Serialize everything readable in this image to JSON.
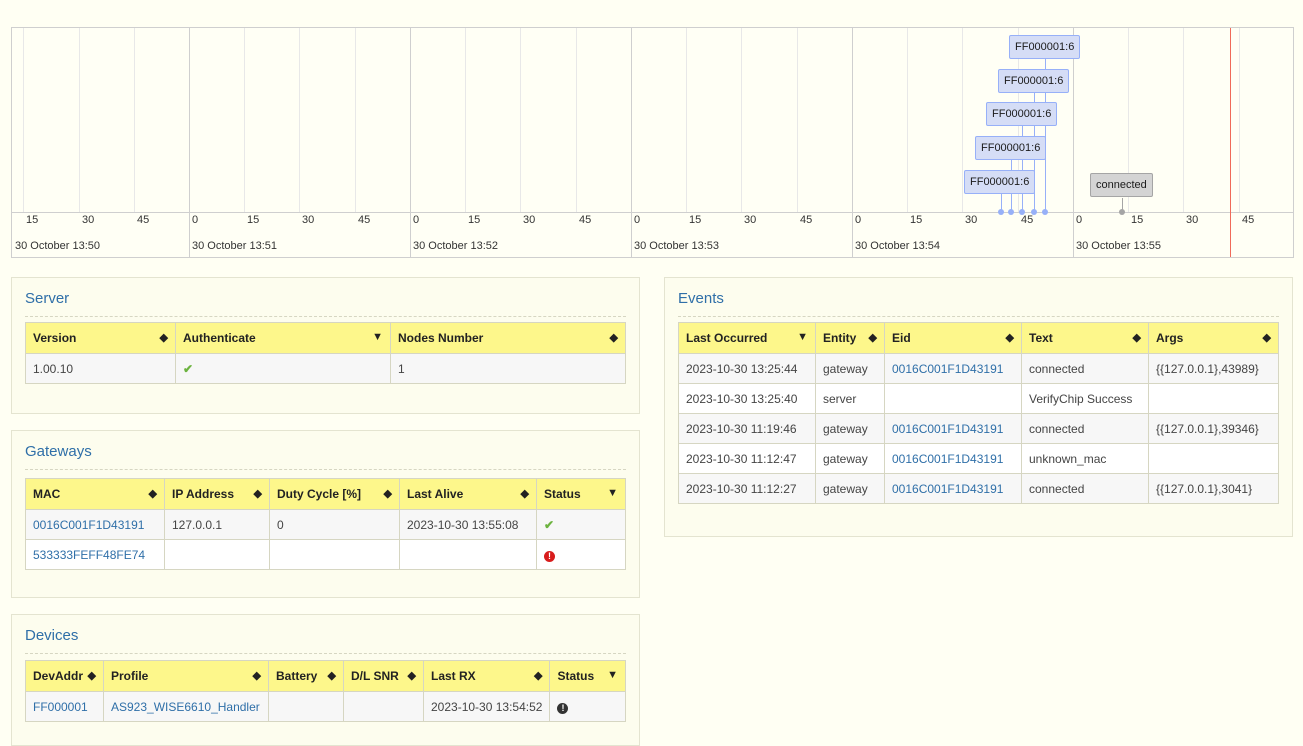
{
  "timeline": {
    "minutes": [
      {
        "label": "30 October 13:50",
        "ticks": [
          "15",
          "30",
          "45"
        ]
      },
      {
        "label": "30 October 13:51",
        "ticks": [
          "0",
          "15",
          "30",
          "45"
        ]
      },
      {
        "label": "30 October 13:52",
        "ticks": [
          "0",
          "15",
          "30",
          "45"
        ]
      },
      {
        "label": "30 October 13:53",
        "ticks": [
          "0",
          "15",
          "30",
          "45"
        ]
      },
      {
        "label": "30 October 13:54",
        "ticks": [
          "0",
          "15",
          "30",
          "45"
        ]
      },
      {
        "label": "30 October 13:55",
        "ticks": [
          "0",
          "15",
          "30",
          "45"
        ]
      }
    ],
    "items": [
      {
        "text": "FF000001:6",
        "kind": "frame"
      },
      {
        "text": "FF000001:6",
        "kind": "frame"
      },
      {
        "text": "FF000001:6",
        "kind": "frame"
      },
      {
        "text": "FF000001:6",
        "kind": "frame"
      },
      {
        "text": "FF000001:6",
        "kind": "frame"
      },
      {
        "text": "connected",
        "kind": "event"
      }
    ]
  },
  "server": {
    "title": "Server",
    "columns": [
      "Version",
      "Authenticate",
      "Nodes Number"
    ],
    "rows": [
      {
        "version": "1.00.10",
        "authenticate": "✔",
        "nodes": "1"
      }
    ]
  },
  "gateways": {
    "title": "Gateways",
    "columns": [
      "MAC",
      "IP Address",
      "Duty Cycle [%]",
      "Last Alive",
      "Status"
    ],
    "rows": [
      {
        "mac": "0016C001F1D43191",
        "ip": "127.0.0.1",
        "duty": "0",
        "alive": "2023-10-30 13:55:08",
        "status": "✔"
      },
      {
        "mac": "533333FEFF48FE74",
        "ip": "",
        "duty": "",
        "alive": "",
        "status": "!"
      }
    ]
  },
  "devices": {
    "title": "Devices",
    "columns": [
      "DevAddr",
      "Profile",
      "Battery",
      "D/L SNR",
      "Last RX",
      "Status"
    ],
    "rows": [
      {
        "devaddr": "FF000001",
        "profile": "AS923_WISE6610_Handler",
        "battery": "",
        "snr": "",
        "lastrx": "2023-10-30 13:54:52",
        "status": "!"
      }
    ]
  },
  "events": {
    "title": "Events",
    "columns": [
      "Last Occurred",
      "Entity",
      "Eid",
      "Text",
      "Args"
    ],
    "rows": [
      {
        "time": "2023-10-30 13:25:44",
        "entity": "gateway",
        "eid": "0016C001F1D43191",
        "text": "connected",
        "args": "{{127.0.0.1},43989}"
      },
      {
        "time": "2023-10-30 13:25:40",
        "entity": "server",
        "eid": "",
        "text": "VerifyChip Success",
        "args": ""
      },
      {
        "time": "2023-10-30 11:19:46",
        "entity": "gateway",
        "eid": "0016C001F1D43191",
        "text": "connected",
        "args": "{{127.0.0.1},39346}"
      },
      {
        "time": "2023-10-30 11:12:47",
        "entity": "gateway",
        "eid": "0016C001F1D43191",
        "text": "unknown_mac",
        "args": ""
      },
      {
        "time": "2023-10-30 11:12:27",
        "entity": "gateway",
        "eid": "0016C001F1D43191",
        "text": "connected",
        "args": "{{127.0.0.1},3041}"
      }
    ]
  }
}
